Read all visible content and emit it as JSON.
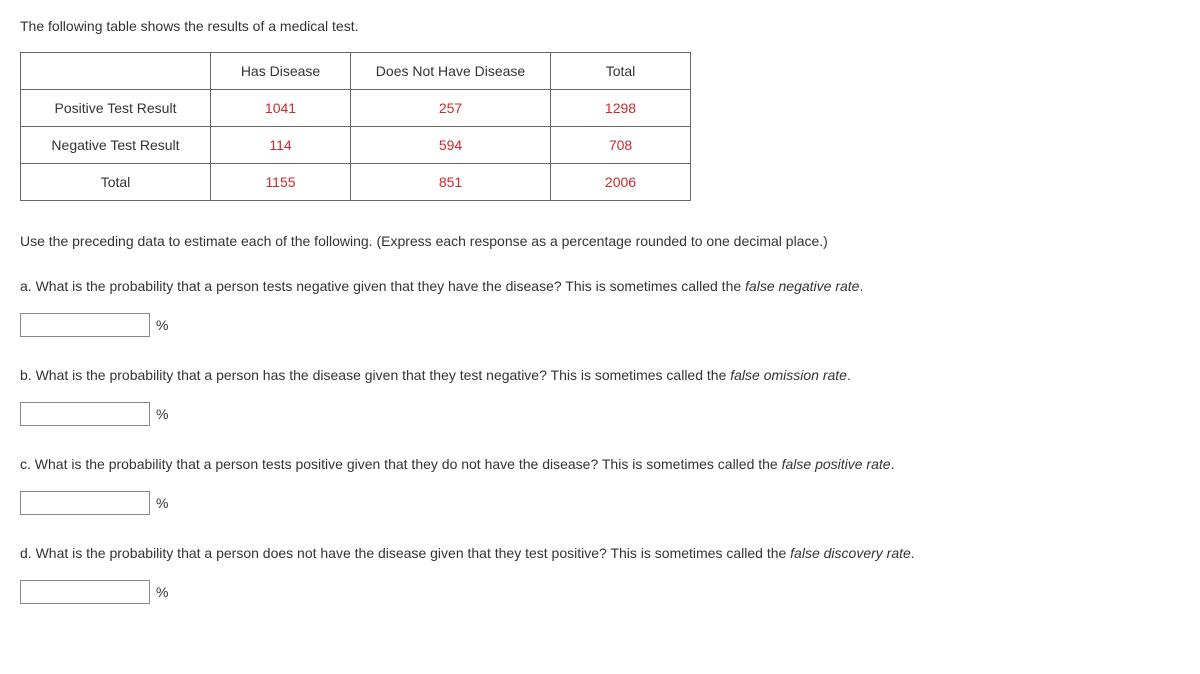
{
  "intro": "The following table shows the results of a medical test.",
  "table": {
    "headers": {
      "col1": "Has Disease",
      "col2": "Does Not Have Disease",
      "col3": "Total"
    },
    "rows": {
      "positive": {
        "label": "Positive Test Result",
        "c1": "1041",
        "c2": "257",
        "c3": "1298"
      },
      "negative": {
        "label": "Negative Test Result",
        "c1": "114",
        "c2": "594",
        "c3": "708"
      },
      "total": {
        "label": "Total",
        "c1": "1155",
        "c2": "851",
        "c3": "2006"
      }
    }
  },
  "instructions": "Use the preceding data to estimate each of the following. (Express each response as a percentage rounded to one decimal place.)",
  "questions": {
    "a": {
      "prefix": "a. What is the probability that a person tests negative given that they have the disease? This is sometimes called the ",
      "em": "false negative rate",
      "suffix": "."
    },
    "b": {
      "prefix": "b. What is the probability that a person has the disease given that they test negative? This is sometimes called the ",
      "em": "false omission rate",
      "suffix": "."
    },
    "c": {
      "prefix": "c. What is the probability that a person tests positive given that they do not have the disease? This is sometimes called the ",
      "em": "false positive rate",
      "suffix": "."
    },
    "d": {
      "prefix": "d. What is the probability that a person does not have the disease given that they test positive? This is sometimes called the ",
      "em": "false discovery rate",
      "suffix": "."
    }
  },
  "unit": "%"
}
